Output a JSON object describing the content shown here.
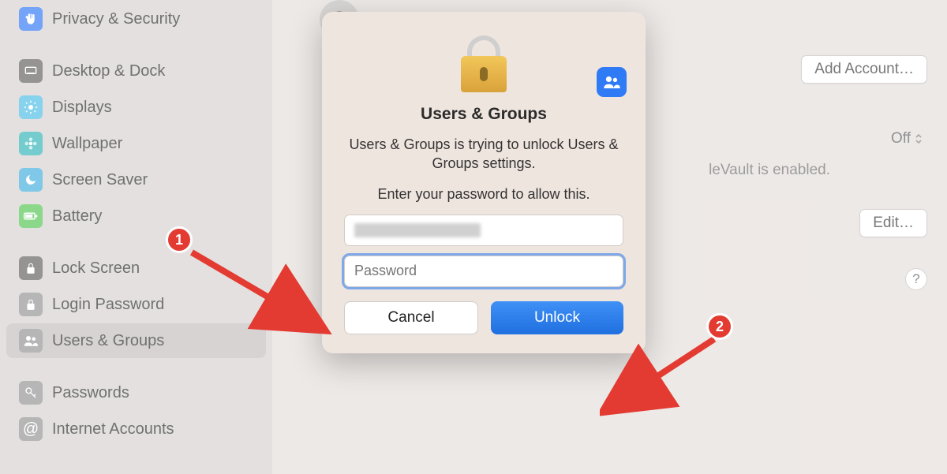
{
  "sidebar": {
    "items": [
      {
        "label": "Privacy & Security",
        "icon": "hand-icon"
      },
      {
        "spacer": true
      },
      {
        "label": "Desktop & Dock",
        "icon": "dock-icon"
      },
      {
        "label": "Displays",
        "icon": "sun-icon"
      },
      {
        "label": "Wallpaper",
        "icon": "flower-icon"
      },
      {
        "label": "Screen Saver",
        "icon": "moon-icon"
      },
      {
        "label": "Battery",
        "icon": "battery-icon"
      },
      {
        "spacer": true
      },
      {
        "label": "Lock Screen",
        "icon": "lock-icon"
      },
      {
        "label": "Login Password",
        "icon": "padlock-icon"
      },
      {
        "label": "Users & Groups",
        "icon": "users-icon",
        "selected": true
      },
      {
        "spacer": true
      },
      {
        "label": "Passwords",
        "icon": "key-icon"
      },
      {
        "label": "Internet Accounts",
        "icon": "at-icon"
      }
    ]
  },
  "main": {
    "user_status": "Off",
    "add_account_label": "Add Account…",
    "filevault_off": "Off",
    "filevault_note": "leVault is enabled.",
    "edit_label": "Edit…"
  },
  "modal": {
    "title": "Users & Groups",
    "body": "Users & Groups is trying to unlock Users & Groups settings.",
    "prompt": "Enter your password to allow this.",
    "password_placeholder": "Password",
    "cancel_label": "Cancel",
    "unlock_label": "Unlock"
  },
  "annotations": {
    "badge1": "1",
    "badge2": "2"
  }
}
